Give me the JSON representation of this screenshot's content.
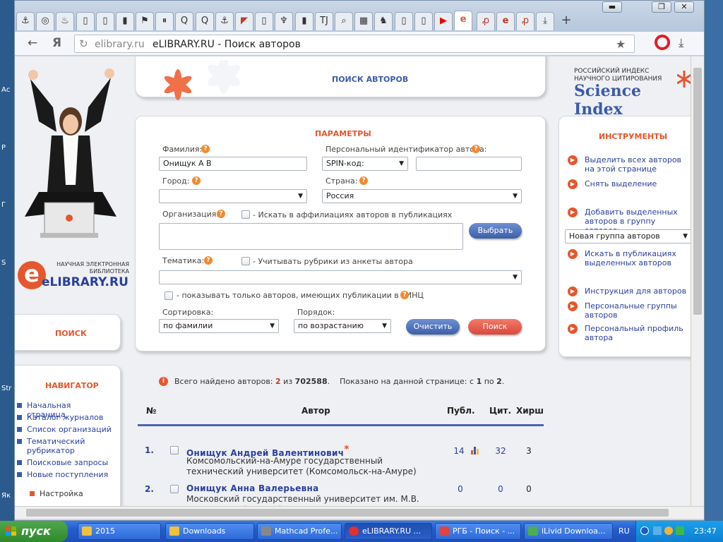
{
  "desktop": {
    "labels": [
      "Ас",
      "Р",
      "Г",
      "S",
      "Str",
      "Як"
    ]
  },
  "browser": {
    "tabs": [
      "⚓",
      "◎",
      "♨",
      "▯",
      "▯",
      "▮",
      "⚑",
      "⏸",
      "Q",
      "Q",
      "⚓",
      "◤",
      "▯",
      "♆",
      "▮",
      "TJ",
      "⌕",
      "▦",
      "♞",
      "▯",
      "▯",
      "▶",
      "e",
      "ꝓ",
      "e",
      "ꝓ",
      "⤓"
    ],
    "active_tab_index": 22,
    "new_tab": "+",
    "window_buttons": [
      "▬",
      "❐",
      "✕"
    ],
    "url_domain": "elibrary.ru",
    "page_title": "eLIBRARY.RU - Поиск авторов",
    "nav": {
      "back": "←",
      "yandex": "Я",
      "refresh": "↻",
      "star": "★",
      "opera": "O",
      "download": "⤓"
    }
  },
  "page": {
    "header_title": "ПОИСК АВТОРОВ",
    "science_index": {
      "line1": "РОССИЙСКИЙ ИНДЕКС",
      "line2": "НАУЧНОГО ЦИТИРОВАНИЯ",
      "brand": "Science Index"
    },
    "elibrary_logo": {
      "line1": "НАУЧНАЯ ЭЛЕКТРОННАЯ",
      "line2": "БИБЛИОТЕКА",
      "brand": "eLIBRARY.RU"
    },
    "left_search_label": "ПОИСК",
    "navigator": {
      "title": "НАВИГАТОР",
      "items": [
        "Начальная страница",
        "Каталог журналов",
        "Список организаций",
        "Тематический рубрикатор",
        "Поисковые запросы",
        "Новые поступления"
      ],
      "settings": "Настройка"
    },
    "params": {
      "title": "ПАРАМЕТРЫ",
      "surname_label": "Фамилия:",
      "surname_value": "Онищук А В",
      "author_id_label": "Персональный идентификатор автора:",
      "id_type_value": "SPIN-код:",
      "id_value": "",
      "city_label": "Город:",
      "city_value": "",
      "country_label": "Страна:",
      "country_value": "Россия",
      "org_label": "Организация:",
      "affil_check_label": "- Искать в аффилиациях авторов в публикациях",
      "select_button": "Выбрать",
      "topic_label": "Тематика:",
      "topic_check_label": "- Учитывать рубрики из анкеты автора",
      "rinc_check_label": "- показывать только авторов, имеющих публикации в РИНЦ",
      "sort_label": "Сортировка:",
      "sort_value": "по фамилии",
      "order_label": "Порядок:",
      "order_value": "по возрастанию",
      "clear_button": "Очистить",
      "search_button": "Поиск"
    },
    "tools": {
      "title": "ИНСТРУМЕНТЫ",
      "select_all": "Выделить всех авторов на этой странице",
      "deselect": "Снять выделение",
      "add_to_group": "Добавить выделенных авторов в группу авторов:",
      "group_value": "Новая группа авторов",
      "search_pubs": "Искать в публикациях выделенных авторов",
      "instructions": "Инструкция для авторов",
      "groups": "Персональные группы авторов",
      "profile": "Персональный профиль автора"
    },
    "results": {
      "found_prefix": "Всего найдено авторов:",
      "found": "2",
      "of": "из",
      "total": "702588",
      "shown_prefix": "Показано на данной странице: с",
      "from": "1",
      "to_word": "по",
      "to": "2",
      "headers": {
        "num": "№",
        "author": "Автор",
        "pubs": "Публ.",
        "cit": "Цит.",
        "hirsch": "Хирш"
      },
      "rows": [
        {
          "num": "1.",
          "name": "Онищук Андрей Валентинович",
          "mark": "*",
          "affiliation": "Комсомольский-на-Амуре государственный технический университет (Комсомольск-на-Амуре)",
          "pubs": "14",
          "cit": "32",
          "hirsch": "3"
        },
        {
          "num": "2.",
          "name": "Онищук Анна Валерьевна",
          "affiliation": "Московский государственный университет им. М.В. Ломоносова (Москва)",
          "pubs": "0",
          "cit": "0",
          "hirsch": "0"
        }
      ]
    }
  },
  "taskbar": {
    "start": "пуск",
    "tasks": [
      "2015",
      "Downloads",
      "Mathcad Profe...",
      "eLIBRARY.RU ...",
      "РГБ - Поиск - ...",
      "iLivid Downloa..."
    ],
    "active_index": 3,
    "lang": "RU",
    "time": "23:47"
  },
  "colors": {
    "accent": "#e4572e",
    "link": "#2a3f9b",
    "blue_btn": "#3c5fa8",
    "red_btn": "#d9483a"
  }
}
